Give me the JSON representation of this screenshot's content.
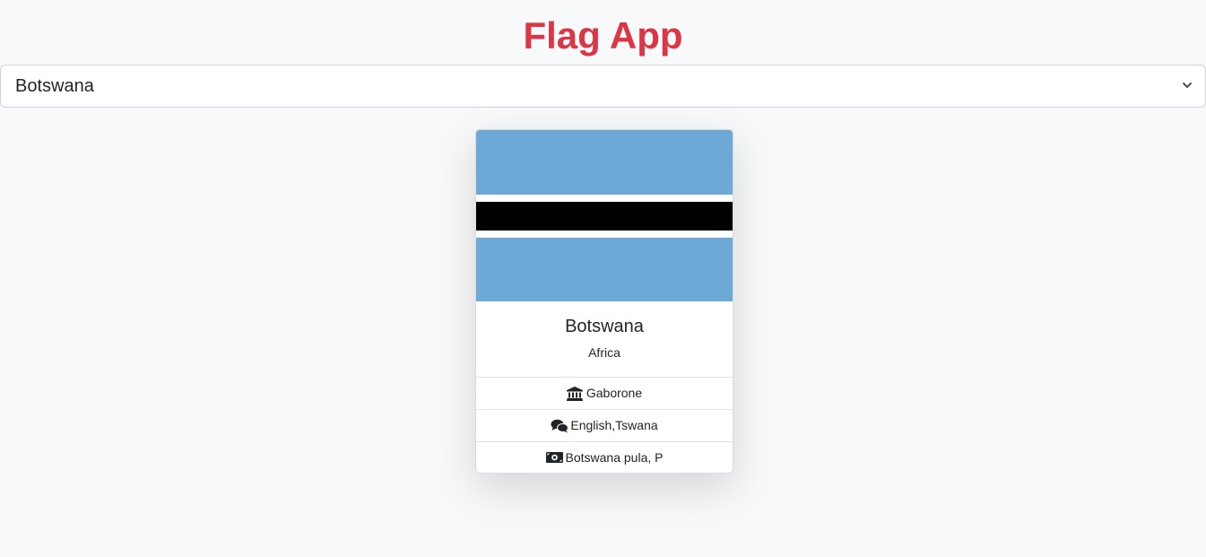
{
  "app": {
    "title": "Flag App",
    "accent_color": "#dc3545"
  },
  "country_select": {
    "selected": "Botswana",
    "icon": "chevron-down-icon"
  },
  "card": {
    "flag": {
      "country": "Botswana",
      "colors": {
        "sky_blue": "#6da9d6",
        "white": "#ffffff",
        "black": "#000000"
      }
    },
    "name": "Botswana",
    "region": "Africa",
    "capital": {
      "icon": "landmark-icon",
      "value": "Gaborone"
    },
    "languages": {
      "icon": "comments-icon",
      "value": "English,Tswana"
    },
    "currency": {
      "icon": "money-bill-icon",
      "value": "Botswana pula, P"
    }
  }
}
